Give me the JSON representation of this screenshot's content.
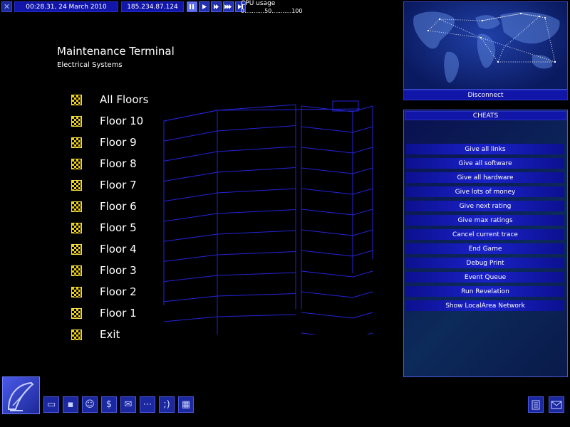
{
  "topbar": {
    "datetime": "00:28.31, 24 March 2010",
    "ip": "185.234.87.124",
    "cpu_label": "CPU usage",
    "cpu_scale": "0...........50...........100",
    "speed_buttons": [
      "pause-icon",
      "play-icon",
      "fast-icon",
      "faster-icon",
      "fastest-icon"
    ]
  },
  "terminal": {
    "title": "Maintenance Terminal",
    "subtitle": "Electrical Systems"
  },
  "menu": [
    {
      "label": "All Floors"
    },
    {
      "label": "Floor 10"
    },
    {
      "label": "Floor 9"
    },
    {
      "label": "Floor 8"
    },
    {
      "label": "Floor 7"
    },
    {
      "label": "Floor 6"
    },
    {
      "label": "Floor 5"
    },
    {
      "label": "Floor 4"
    },
    {
      "label": "Floor 3"
    },
    {
      "label": "Floor 2"
    },
    {
      "label": "Floor 1"
    },
    {
      "label": "Exit"
    }
  ],
  "map": {
    "disconnect_label": "Disconnect"
  },
  "cheats": {
    "title": "CHEATS",
    "buttons": [
      "Give all links",
      "Give all software",
      "Give all hardware",
      "Give lots of money",
      "Give next rating",
      "Give max ratings",
      "Cancel current trace",
      "End Game",
      "Debug Print",
      "Event Queue",
      "Run Revelation",
      "Show LocalArea Network"
    ]
  },
  "toolbar": {
    "tools": [
      "computer-icon",
      "save-icon",
      "people-icon",
      "dollar-icon",
      "mail-icon",
      "network-icon",
      "chat-icon",
      "lan-icon"
    ],
    "tool_glyphs": [
      "▭",
      "▪",
      "☺",
      "$",
      "✉",
      "⋯",
      ";)",
      "▦"
    ],
    "right_tools": [
      "notes-icon",
      "email-icon"
    ],
    "dollar": "$",
    "wink": ";)"
  },
  "colors": {
    "accent": "#1116a8",
    "wireframe": "#2a2ad8",
    "menu_icon": "#f0d010"
  }
}
